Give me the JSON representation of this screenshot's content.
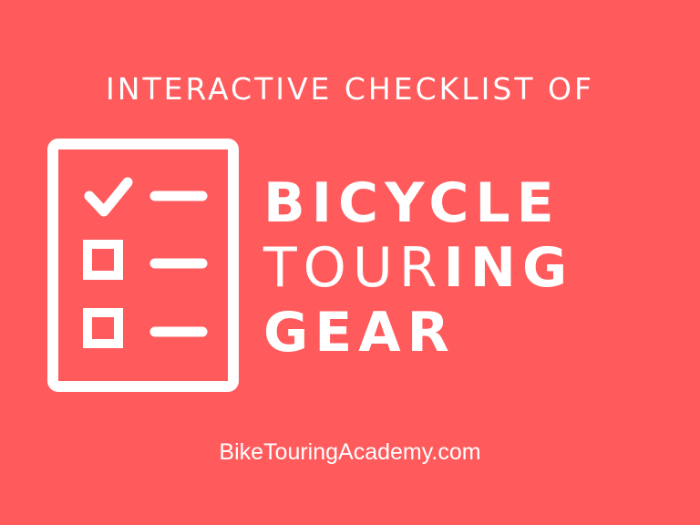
{
  "header": {
    "subtitle": "INTERACTIVE CHECKLIST OF"
  },
  "title": {
    "line1": "BICYCLE",
    "line2_light": "TOUR",
    "line2_bold": "ING",
    "line3": "GEAR"
  },
  "footer": {
    "url": "BikeTouringAcademy.com"
  },
  "icon": {
    "name": "checklist-icon"
  },
  "colors": {
    "background": "#FF5A5C",
    "foreground": "#FFFFFF"
  }
}
